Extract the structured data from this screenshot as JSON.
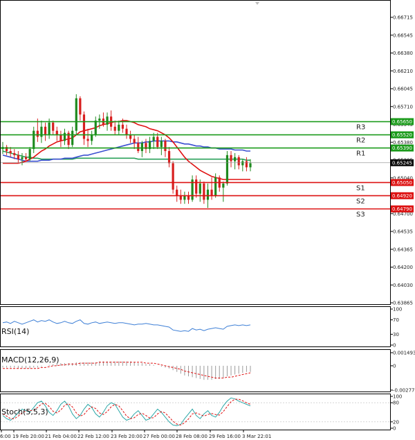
{
  "colors": {
    "bull": "#1e8a1e",
    "bear": "#d81e1e",
    "ma_fast": "#e01010",
    "ma_mid": "#3a4fd0",
    "ma_slow": "#2aa05a",
    "resistance": "#1a9a1a",
    "support": "#dd1111",
    "current_badge": "#0b0b0b",
    "rsi": "#3d7fd6",
    "macd_hist": "#9a9a9a",
    "macd_signal": "#e01010",
    "stoch_main": "#2aa7a7",
    "stoch_signal": "#e01010"
  },
  "chart_data": [
    {
      "type": "candlestick",
      "id": "price",
      "ylim": [
        0.63865,
        0.6678
      ],
      "yticks": [
        "0.66715",
        "0.66545",
        "0.66380",
        "0.66210",
        "0.66045",
        "0.65710",
        "0.65545",
        "0.65380",
        "0.65205",
        "0.65040",
        "0.64870",
        "0.64700",
        "0.64535",
        "0.64365",
        "0.64200",
        "0.64030",
        "0.63865"
      ],
      "x_labels": [
        "6:00",
        "19 Feb 20:00",
        "21 Feb 04:00",
        "22 Feb 12:00",
        "23 Feb 20:00",
        "27 Feb 00:00",
        "28 Feb 08:00",
        "29 Feb 16:00",
        "3 Mar 22:01"
      ],
      "candles": [
        {
          "o": 0.6538,
          "h": 0.6545,
          "l": 0.6533,
          "c": 0.654
        },
        {
          "o": 0.654,
          "h": 0.6542,
          "l": 0.6532,
          "c": 0.6536
        },
        {
          "o": 0.6536,
          "h": 0.654,
          "l": 0.653,
          "c": 0.6534
        },
        {
          "o": 0.6534,
          "h": 0.6538,
          "l": 0.6528,
          "c": 0.6532
        },
        {
          "o": 0.6532,
          "h": 0.6536,
          "l": 0.6524,
          "c": 0.6528
        },
        {
          "o": 0.6528,
          "h": 0.6534,
          "l": 0.6522,
          "c": 0.653
        },
        {
          "o": 0.653,
          "h": 0.6534,
          "l": 0.6526,
          "c": 0.6528
        },
        {
          "o": 0.6528,
          "h": 0.654,
          "l": 0.6526,
          "c": 0.6538
        },
        {
          "o": 0.6538,
          "h": 0.656,
          "l": 0.6534,
          "c": 0.6556
        },
        {
          "o": 0.6556,
          "h": 0.6568,
          "l": 0.6545,
          "c": 0.655
        },
        {
          "o": 0.655,
          "h": 0.6566,
          "l": 0.6544,
          "c": 0.656
        },
        {
          "o": 0.656,
          "h": 0.6564,
          "l": 0.6546,
          "c": 0.6552
        },
        {
          "o": 0.6552,
          "h": 0.6568,
          "l": 0.6548,
          "c": 0.6564
        },
        {
          "o": 0.6564,
          "h": 0.6566,
          "l": 0.6552,
          "c": 0.6556
        },
        {
          "o": 0.6556,
          "h": 0.656,
          "l": 0.6546,
          "c": 0.6552
        },
        {
          "o": 0.6552,
          "h": 0.6556,
          "l": 0.654,
          "c": 0.6546
        },
        {
          "o": 0.6546,
          "h": 0.6558,
          "l": 0.6542,
          "c": 0.6554
        },
        {
          "o": 0.6554,
          "h": 0.6556,
          "l": 0.6538,
          "c": 0.6542
        },
        {
          "o": 0.6542,
          "h": 0.656,
          "l": 0.654,
          "c": 0.6556
        },
        {
          "o": 0.6556,
          "h": 0.6592,
          "l": 0.6552,
          "c": 0.6588
        },
        {
          "o": 0.6588,
          "h": 0.659,
          "l": 0.6566,
          "c": 0.6572
        },
        {
          "o": 0.6572,
          "h": 0.6575,
          "l": 0.6542,
          "c": 0.6548
        },
        {
          "o": 0.6548,
          "h": 0.6558,
          "l": 0.654,
          "c": 0.6546
        },
        {
          "o": 0.6546,
          "h": 0.6556,
          "l": 0.6542,
          "c": 0.6552
        },
        {
          "o": 0.6552,
          "h": 0.657,
          "l": 0.655,
          "c": 0.6566
        },
        {
          "o": 0.6566,
          "h": 0.6572,
          "l": 0.6558,
          "c": 0.6568
        },
        {
          "o": 0.6568,
          "h": 0.6574,
          "l": 0.656,
          "c": 0.6562
        },
        {
          "o": 0.6562,
          "h": 0.6574,
          "l": 0.6556,
          "c": 0.657
        },
        {
          "o": 0.657,
          "h": 0.6576,
          "l": 0.6556,
          "c": 0.656
        },
        {
          "o": 0.656,
          "h": 0.6566,
          "l": 0.6552,
          "c": 0.6556
        },
        {
          "o": 0.6556,
          "h": 0.6566,
          "l": 0.6552,
          "c": 0.6562
        },
        {
          "o": 0.6562,
          "h": 0.6568,
          "l": 0.6554,
          "c": 0.6558
        },
        {
          "o": 0.6558,
          "h": 0.6562,
          "l": 0.6548,
          "c": 0.6552
        },
        {
          "o": 0.6552,
          "h": 0.6556,
          "l": 0.6544,
          "c": 0.6548
        },
        {
          "o": 0.6548,
          "h": 0.6552,
          "l": 0.6538,
          "c": 0.6544
        },
        {
          "o": 0.6544,
          "h": 0.655,
          "l": 0.6534,
          "c": 0.6536
        },
        {
          "o": 0.6536,
          "h": 0.6546,
          "l": 0.653,
          "c": 0.6544
        },
        {
          "o": 0.6544,
          "h": 0.6548,
          "l": 0.6534,
          "c": 0.6538
        },
        {
          "o": 0.6538,
          "h": 0.655,
          "l": 0.6534,
          "c": 0.6546
        },
        {
          "o": 0.6546,
          "h": 0.6554,
          "l": 0.6538,
          "c": 0.655
        },
        {
          "o": 0.655,
          "h": 0.6554,
          "l": 0.6538,
          "c": 0.654
        },
        {
          "o": 0.654,
          "h": 0.655,
          "l": 0.6532,
          "c": 0.6546
        },
        {
          "o": 0.6546,
          "h": 0.6548,
          "l": 0.653,
          "c": 0.6536
        },
        {
          "o": 0.6536,
          "h": 0.654,
          "l": 0.652,
          "c": 0.6524
        },
        {
          "o": 0.6524,
          "h": 0.6526,
          "l": 0.6494,
          "c": 0.6498
        },
        {
          "o": 0.6498,
          "h": 0.6502,
          "l": 0.6486,
          "c": 0.6492
        },
        {
          "o": 0.6492,
          "h": 0.6498,
          "l": 0.6484,
          "c": 0.6488
        },
        {
          "o": 0.6488,
          "h": 0.6496,
          "l": 0.6484,
          "c": 0.6492
        },
        {
          "o": 0.6492,
          "h": 0.6496,
          "l": 0.6484,
          "c": 0.6488
        },
        {
          "o": 0.6488,
          "h": 0.6512,
          "l": 0.6486,
          "c": 0.6508
        },
        {
          "o": 0.6508,
          "h": 0.6512,
          "l": 0.649,
          "c": 0.6494
        },
        {
          "o": 0.6494,
          "h": 0.6508,
          "l": 0.6486,
          "c": 0.6504
        },
        {
          "o": 0.6504,
          "h": 0.6506,
          "l": 0.6484,
          "c": 0.6488
        },
        {
          "o": 0.6488,
          "h": 0.6504,
          "l": 0.648,
          "c": 0.6498
        },
        {
          "o": 0.6498,
          "h": 0.651,
          "l": 0.6488,
          "c": 0.6492
        },
        {
          "o": 0.6492,
          "h": 0.6514,
          "l": 0.649,
          "c": 0.651
        },
        {
          "o": 0.651,
          "h": 0.6512,
          "l": 0.6496,
          "c": 0.65
        },
        {
          "o": 0.65,
          "h": 0.6506,
          "l": 0.6486,
          "c": 0.6504
        },
        {
          "o": 0.6504,
          "h": 0.6536,
          "l": 0.6502,
          "c": 0.6532
        },
        {
          "o": 0.6532,
          "h": 0.6536,
          "l": 0.652,
          "c": 0.6526
        },
        {
          "o": 0.6526,
          "h": 0.6534,
          "l": 0.6518,
          "c": 0.653
        },
        {
          "o": 0.653,
          "h": 0.6532,
          "l": 0.6518,
          "c": 0.6522
        },
        {
          "o": 0.6522,
          "h": 0.6528,
          "l": 0.6516,
          "c": 0.6526
        },
        {
          "o": 0.6526,
          "h": 0.653,
          "l": 0.6516,
          "c": 0.652
        },
        {
          "o": 0.652,
          "h": 0.6528,
          "l": 0.6516,
          "c": 0.6524
        }
      ],
      "moving_averages": [
        {
          "key": "ma_fast",
          "values": [
            0.6524,
            0.6524,
            0.6524,
            0.6524,
            0.6524,
            0.6525,
            0.6526,
            0.6528,
            0.653,
            0.6533,
            0.6536,
            0.6538,
            0.6541,
            0.6543,
            0.6545,
            0.6546,
            0.6547,
            0.6548,
            0.6549,
            0.6552,
            0.6555,
            0.6556,
            0.6557,
            0.6558,
            0.6559,
            0.6561,
            0.6562,
            0.6563,
            0.6564,
            0.6565,
            0.6565,
            0.6566,
            0.6566,
            0.6565,
            0.6564,
            0.6562,
            0.6561,
            0.656,
            0.6558,
            0.6557,
            0.6556,
            0.6554,
            0.6552,
            0.6549,
            0.6545,
            0.654,
            0.6535,
            0.653,
            0.6526,
            0.6523,
            0.652,
            0.6517,
            0.6515,
            0.6513,
            0.6511,
            0.651,
            0.6509,
            0.6508,
            0.6508,
            0.6508,
            0.6508,
            0.6508,
            0.6508,
            0.6508,
            0.6508
          ]
        },
        {
          "key": "ma_mid",
          "values": [
            0.6532,
            0.6531,
            0.653,
            0.6529,
            0.6528,
            0.6527,
            0.6526,
            0.6526,
            0.6526,
            0.6526,
            0.6527,
            0.6527,
            0.6527,
            0.6528,
            0.6528,
            0.6528,
            0.6529,
            0.6529,
            0.6529,
            0.653,
            0.6531,
            0.6532,
            0.6532,
            0.6533,
            0.6534,
            0.6535,
            0.6536,
            0.6537,
            0.6538,
            0.6539,
            0.654,
            0.6541,
            0.6542,
            0.6543,
            0.6544,
            0.6544,
            0.6544,
            0.6545,
            0.6545,
            0.6546,
            0.6546,
            0.6546,
            0.6546,
            0.6546,
            0.6545,
            0.6545,
            0.6544,
            0.6543,
            0.6543,
            0.6542,
            0.6541,
            0.6541,
            0.654,
            0.654,
            0.6539,
            0.6539,
            0.6538,
            0.6538,
            0.6538,
            0.6538,
            0.6537,
            0.6537,
            0.6537,
            0.6536,
            0.6536
          ]
        },
        {
          "key": "ma_slow",
          "values": [
            0.6536,
            0.6535,
            0.6534,
            0.6533,
            0.6532,
            0.6531,
            0.653,
            0.653,
            0.6529,
            0.6529,
            0.6528,
            0.6528,
            0.6528,
            0.6528,
            0.6528,
            0.6528,
            0.6528,
            0.6528,
            0.6528,
            0.6529,
            0.6529,
            0.6529,
            0.6529,
            0.6529,
            0.6529,
            0.6529,
            0.6529,
            0.6529,
            0.6529,
            0.6529,
            0.6529,
            0.6529,
            0.6529,
            0.6529,
            0.6529,
            0.6528,
            0.6528,
            0.6528,
            0.6528,
            0.6528,
            0.6528,
            0.6528,
            0.6528,
            0.6528,
            0.6528,
            0.6528,
            0.6528,
            0.6528,
            0.6528,
            0.6528,
            0.6528,
            0.6528,
            0.6528,
            0.6528,
            0.6528,
            0.6528,
            0.6528,
            0.6528,
            0.6528,
            0.6528,
            0.6528,
            0.6528,
            0.6528,
            0.6527,
            0.6527
          ]
        }
      ],
      "levels": [
        {
          "label": "R3",
          "price": "0.65650",
          "value": 0.6565,
          "kind": "resistance"
        },
        {
          "label": "R2",
          "price": "0.65520",
          "value": 0.6552,
          "kind": "resistance"
        },
        {
          "label": "R1",
          "price": "0.65390",
          "value": 0.6539,
          "kind": "resistance"
        },
        {
          "label": "S1",
          "price": "0.65050",
          "value": 0.6505,
          "kind": "support"
        },
        {
          "label": "S2",
          "price": "0.64920",
          "value": 0.6492,
          "kind": "support"
        },
        {
          "label": "S3",
          "price": "0.64790",
          "value": 0.6479,
          "kind": "support"
        }
      ],
      "current_price": {
        "price": "0.65245",
        "value": 0.65245
      }
    },
    {
      "type": "line",
      "id": "rsi",
      "title": "RSI(14)",
      "ylim": [
        0,
        100
      ],
      "yticks": [
        "100",
        "70",
        "30",
        "0"
      ],
      "values": [
        62,
        64,
        60,
        66,
        62,
        58,
        62,
        66,
        70,
        64,
        68,
        66,
        70,
        64,
        60,
        62,
        66,
        62,
        60,
        66,
        70,
        60,
        58,
        62,
        64,
        60,
        62,
        64,
        62,
        60,
        62,
        62,
        60,
        58,
        56,
        58,
        58,
        60,
        58,
        56,
        56,
        54,
        52,
        50,
        42,
        40,
        38,
        40,
        38,
        46,
        42,
        44,
        40,
        44,
        46,
        48,
        46,
        44,
        52,
        54,
        56,
        54,
        56,
        54,
        56
      ]
    },
    {
      "type": "bar",
      "id": "macd",
      "title": "MACD(12,26,9)",
      "ylim": [
        -0.002775,
        0.001493
      ],
      "yticks": [
        "0.001493",
        "0",
        "-0.002775"
      ],
      "values": [
        -0.0002,
        -0.0002,
        -0.0002,
        -0.0002,
        -0.0003,
        -0.0003,
        -0.0003,
        -0.0003,
        -0.0002,
        -0.0002,
        -0.0001,
        0,
        0.0001,
        0.0002,
        0.0003,
        0.0003,
        0.0003,
        0.0003,
        0.0003,
        0.0004,
        0.0004,
        0.0004,
        0.0004,
        0.0004,
        0.0004,
        0.0005,
        0.0005,
        0.0005,
        0.0005,
        0.0005,
        0.0005,
        0.0005,
        0.0005,
        0.0005,
        0.0004,
        0.0003,
        0.0003,
        0.0002,
        0.0002,
        0.0001,
        0,
        -0.0001,
        -0.0002,
        -0.0003,
        -0.0005,
        -0.0007,
        -0.0009,
        -0.0011,
        -0.0012,
        -0.0013,
        -0.0014,
        -0.0015,
        -0.0016,
        -0.0016,
        -0.0016,
        -0.0015,
        -0.0015,
        -0.0014,
        -0.0012,
        -0.0011,
        -0.001,
        -0.0009,
        -0.0008,
        -0.0007,
        -0.0007
      ],
      "signal": [
        -0.0003,
        -0.0003,
        -0.0003,
        -0.0003,
        -0.0003,
        -0.0003,
        -0.0003,
        -0.0003,
        -0.0003,
        -0.0003,
        -0.0002,
        -0.0002,
        -0.0001,
        0,
        0,
        0.0001,
        0.0001,
        0.0002,
        0.0002,
        0.0002,
        0.0003,
        0.0003,
        0.0003,
        0.0003,
        0.0003,
        0.0004,
        0.0004,
        0.0004,
        0.0004,
        0.0004,
        0.0004,
        0.0004,
        0.0004,
        0.0004,
        0.0004,
        0.0004,
        0.0004,
        0.0003,
        0.0003,
        0.0003,
        0.0002,
        0.0001,
        0,
        -0.0001,
        -0.0002,
        -0.0003,
        -0.0004,
        -0.0006,
        -0.0007,
        -0.0008,
        -0.0009,
        -0.001,
        -0.0011,
        -0.0012,
        -0.0013,
        -0.0014,
        -0.0014,
        -0.0014,
        -0.0013,
        -0.0013,
        -0.0012,
        -0.0011,
        -0.001,
        -0.0009,
        -0.0008
      ]
    },
    {
      "type": "line",
      "id": "stoch",
      "title": "Stoch(5,5,3)",
      "ylim": [
        0,
        100
      ],
      "yticks": [
        "100",
        "80",
        "20",
        "0"
      ],
      "main": [
        40,
        30,
        25,
        35,
        50,
        60,
        55,
        50,
        65,
        80,
        85,
        70,
        50,
        40,
        55,
        75,
        85,
        70,
        45,
        30,
        40,
        60,
        75,
        65,
        45,
        35,
        50,
        70,
        80,
        75,
        55,
        35,
        25,
        30,
        45,
        55,
        40,
        25,
        30,
        45,
        60,
        50,
        35,
        20,
        10,
        8,
        12,
        30,
        45,
        60,
        40,
        30,
        45,
        55,
        40,
        35,
        50,
        70,
        85,
        95,
        92,
        85,
        80,
        75,
        70
      ],
      "signal": [
        45,
        38,
        30,
        30,
        38,
        48,
        55,
        55,
        57,
        65,
        76,
        78,
        68,
        53,
        48,
        57,
        72,
        77,
        67,
        48,
        38,
        43,
        58,
        67,
        62,
        48,
        43,
        52,
        67,
        75,
        70,
        55,
        38,
        30,
        33,
        43,
        47,
        40,
        32,
        33,
        45,
        52,
        48,
        35,
        22,
        13,
        10,
        17,
        29,
        45,
        48,
        43,
        38,
        43,
        46,
        43,
        41,
        52,
        68,
        83,
        91,
        91,
        86,
        80,
        75
      ]
    }
  ]
}
